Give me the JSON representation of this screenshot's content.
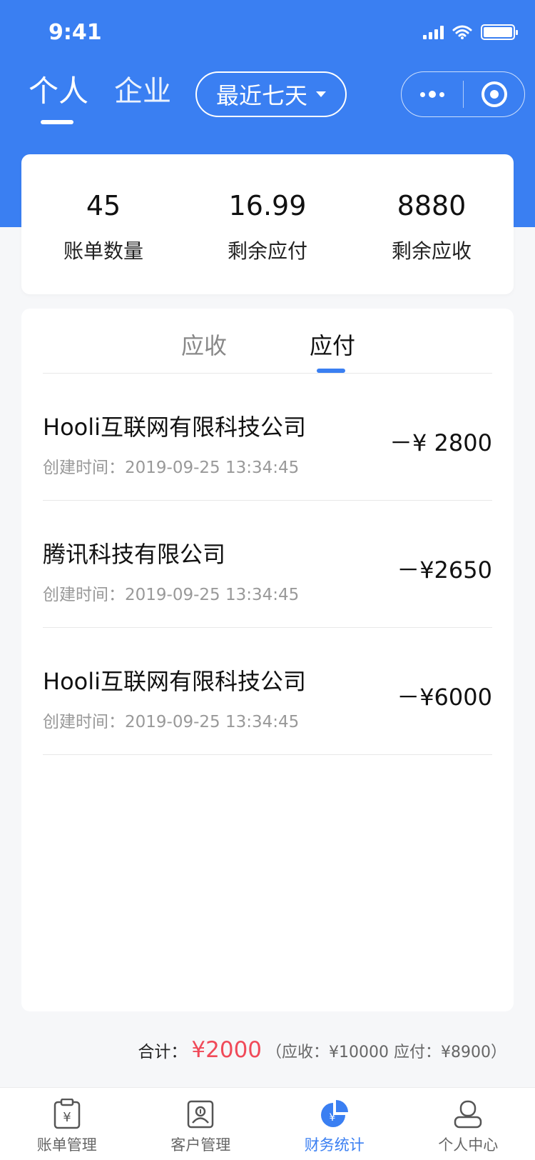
{
  "status_bar": {
    "time": "9:41"
  },
  "header": {
    "tabs": [
      {
        "label": "个人",
        "active": true
      },
      {
        "label": "企业",
        "active": false
      }
    ],
    "range_select": {
      "value": "最近七天"
    }
  },
  "summary": {
    "items": [
      {
        "value": "45",
        "label": "账单数量"
      },
      {
        "value": "16.99",
        "label": "剩余应付"
      },
      {
        "value": "8880",
        "label": "剩余应收"
      }
    ]
  },
  "list": {
    "tabs": [
      {
        "label": "应收",
        "active": false
      },
      {
        "label": "应付",
        "active": true
      }
    ],
    "rows": [
      {
        "name": "Hooli互联网有限科技公司",
        "time": "创建时间：2019-09-25 13:34:45",
        "amount": "－¥ 2800"
      },
      {
        "name": "腾讯科技有限公司",
        "time": "创建时间：2019-09-25 13:34:45",
        "amount": "－¥2650"
      },
      {
        "name": "Hooli互联网有限科技公司",
        "time": "创建时间：2019-09-25 13:34:45",
        "amount": "－¥6000"
      }
    ]
  },
  "total": {
    "label": "合计：",
    "value": "¥2000",
    "detail": "（应收：¥10000 应付：¥8900）"
  },
  "bottom_nav": {
    "items": [
      {
        "label": "账单管理",
        "icon": "bill-icon",
        "active": false
      },
      {
        "label": "客户管理",
        "icon": "customer-icon",
        "active": false
      },
      {
        "label": "财务统计",
        "icon": "finance-chart-icon",
        "active": true
      },
      {
        "label": "个人中心",
        "icon": "profile-icon",
        "active": false
      }
    ]
  },
  "colors": {
    "primary": "#3a7ff2",
    "total_highlight": "#f04a59",
    "background": "#f6f7f9"
  }
}
